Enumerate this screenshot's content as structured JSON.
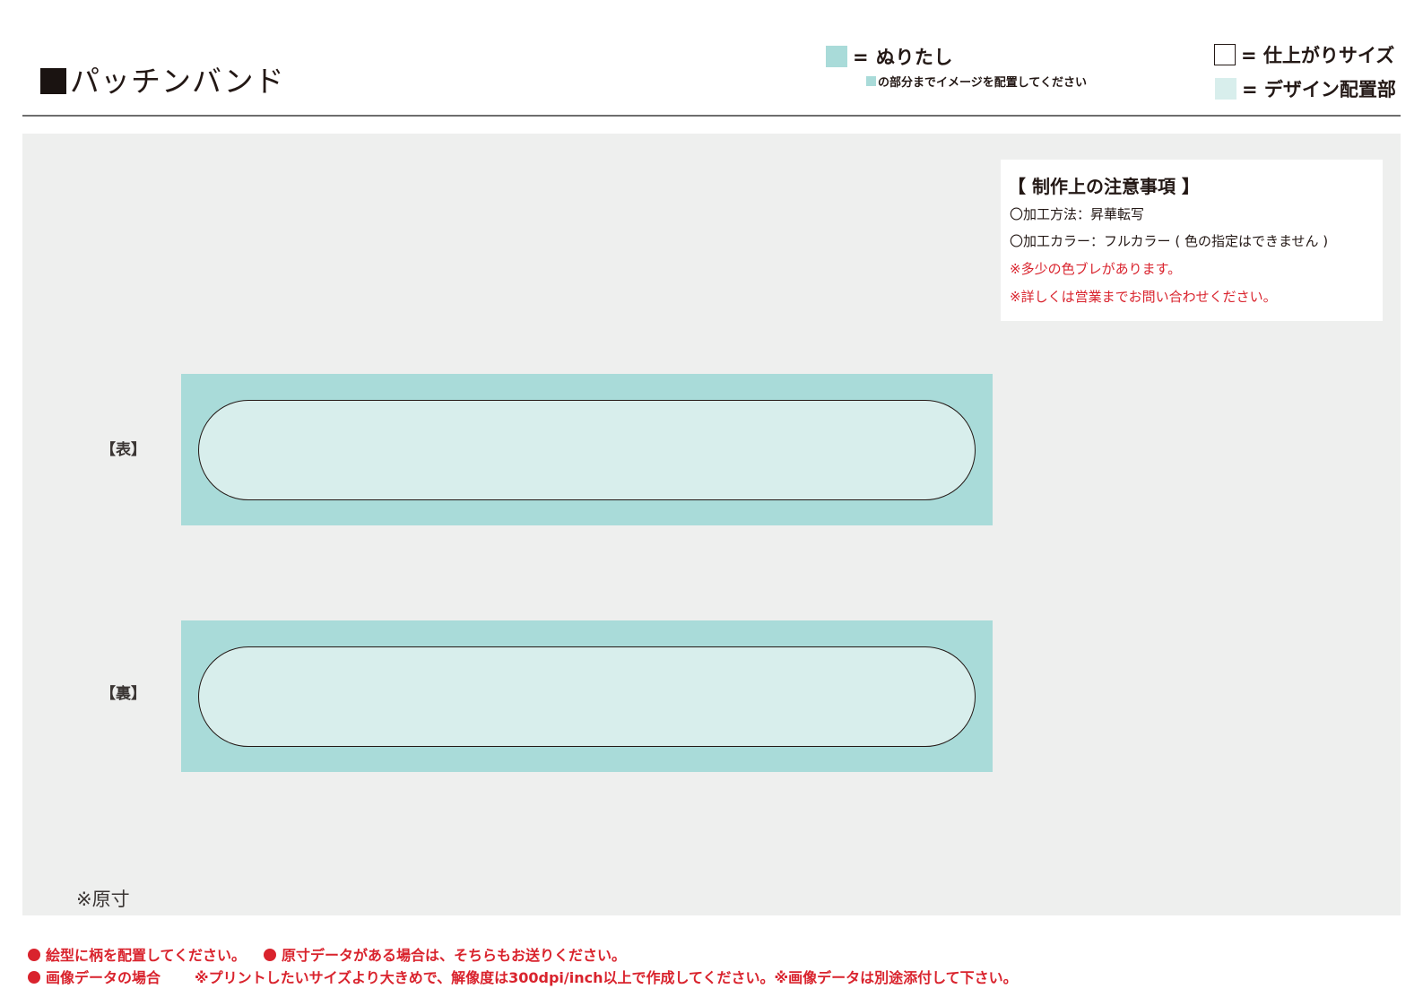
{
  "header": {
    "title": "パッチンバンド",
    "legend": {
      "bleed_label": "= ぬりたし",
      "bleed_note": "の部分までイメージを配置してください",
      "finish_label": "= 仕上がりサイズ",
      "design_label": "= デザイン配置部"
    }
  },
  "notes": {
    "title": "【 制作上の注意事項 】",
    "lines": [
      "〇加工方法：昇華転写",
      "〇加工カラー：フルカラー ( 色の指定はできません )",
      "※多少の色ブレがあります。",
      "※詳しくは営業までお問い合わせください。"
    ]
  },
  "sides": {
    "front_label": "【表】",
    "back_label": "【裏】"
  },
  "actual_size_note": "※原寸",
  "footer": {
    "line1_a": "絵型に柄を配置してください。",
    "line1_b": "原寸データがある場合は、そちらもお送りください。",
    "line2_a": "画像データの場合",
    "line2_b": "※プリントしたいサイズより大きめで、解像度は300dpi/inch以上で作成してください。※画像データは別途添付して下さい。"
  },
  "colors": {
    "bleed": "#a9dbd9",
    "design_area": "#d8eeec",
    "work_background": "#eeefee",
    "warning_red": "#d9232d"
  }
}
